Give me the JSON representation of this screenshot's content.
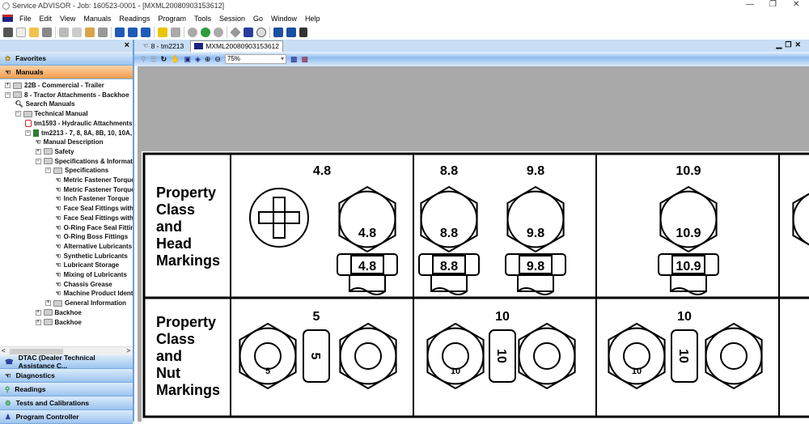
{
  "window": {
    "title": "Service ADVISOR - Job: 160523-0001 - [MXML20080903153612]",
    "controls": [
      "—",
      "❐",
      "✕"
    ]
  },
  "menu": [
    "File",
    "Edit",
    "View",
    "Manuals",
    "Readings",
    "Program",
    "Tools",
    "Session",
    "Go",
    "Window",
    "Help"
  ],
  "left_panel": {
    "close": "×",
    "favorites": "Favorites",
    "manuals": "Manuals",
    "tree": [
      {
        "label": "22B - Commercial - Trailer",
        "level": 0,
        "type": "folder",
        "exp": "+"
      },
      {
        "label": "8 - Tractor Attachments - Backhoe",
        "level": 0,
        "type": "folder",
        "exp": "-"
      },
      {
        "label": "Search Manuals",
        "level": 1,
        "type": "search",
        "exp": ""
      },
      {
        "label": "Technical Manual",
        "level": 1,
        "type": "folder",
        "exp": "-"
      },
      {
        "label": "tm1593 - Hydraulic Attachments",
        "level": 2,
        "type": "pdf",
        "exp": ""
      },
      {
        "label": "tm2213 - 7, 8, 8A, 8B, 10, 10A,",
        "level": 2,
        "type": "book",
        "exp": "-"
      },
      {
        "label": "Manual Description",
        "level": 3,
        "type": "doc",
        "exp": ""
      },
      {
        "label": "Safety",
        "level": 3,
        "type": "folder",
        "exp": "+"
      },
      {
        "label": "Specifications & Information",
        "level": 3,
        "type": "folder",
        "exp": "-"
      },
      {
        "label": "Specifications",
        "level": 4,
        "type": "folder",
        "exp": "-"
      },
      {
        "label": "Metric Fastener Torque",
        "level": 5,
        "type": "doc",
        "exp": ""
      },
      {
        "label": "Metric Fastener Torque",
        "level": 5,
        "type": "doc",
        "exp": ""
      },
      {
        "label": "Inch Fastener Torque",
        "level": 5,
        "type": "doc",
        "exp": ""
      },
      {
        "label": "Face Seal Fittings with",
        "level": 5,
        "type": "doc",
        "exp": ""
      },
      {
        "label": "Face Seal Fittings with",
        "level": 5,
        "type": "doc",
        "exp": ""
      },
      {
        "label": "O-Ring Face Seal Fittings",
        "level": 5,
        "type": "doc",
        "exp": ""
      },
      {
        "label": "O-Ring Boss Fittings",
        "level": 5,
        "type": "doc",
        "exp": ""
      },
      {
        "label": "Alternative Lubricants",
        "level": 5,
        "type": "doc",
        "exp": ""
      },
      {
        "label": "Synthetic Lubricants",
        "level": 5,
        "type": "doc",
        "exp": ""
      },
      {
        "label": "Lubricant Storage",
        "level": 5,
        "type": "doc",
        "exp": ""
      },
      {
        "label": "Mixing of Lubricants",
        "level": 5,
        "type": "doc",
        "exp": ""
      },
      {
        "label": "Chassis Grease",
        "level": 5,
        "type": "doc",
        "exp": ""
      },
      {
        "label": "Machine Product Identification",
        "level": 5,
        "type": "doc",
        "exp": ""
      },
      {
        "label": "General Information",
        "level": 4,
        "type": "folder",
        "exp": "+"
      },
      {
        "label": "Backhoe",
        "level": 3,
        "type": "folder",
        "exp": "+"
      },
      {
        "label": "Backhoe",
        "level": 3,
        "type": "folder",
        "exp": "+"
      }
    ],
    "scroll_left": "<",
    "scroll_right": ">",
    "nav": [
      "DTAC (Dealer Technical Assistance C...",
      "Diagnostics",
      "Readings",
      "Tests and Calibrations",
      "Program Controller"
    ]
  },
  "tabs": [
    {
      "label": "8 - tm2213"
    },
    {
      "label": "MXML20080903153612"
    }
  ],
  "doc_toolbar": {
    "zoom": "75%"
  },
  "document": {
    "head_row_label": [
      "Property",
      "Class",
      "and",
      "Head",
      "Markings"
    ],
    "nut_row_label": [
      "Property",
      "Class",
      "and",
      "Nut",
      "Markings"
    ],
    "head_classes": [
      {
        "title": "4.8",
        "marks": [
          "4.8"
        ]
      },
      {
        "title": "8.8",
        "marks": [
          "8.8"
        ]
      },
      {
        "title": "9.8",
        "marks": [
          "9.8"
        ]
      },
      {
        "title": "10.9",
        "marks": [
          "10.9"
        ]
      }
    ],
    "nut_classes": [
      {
        "title": "5",
        "mark": "5"
      },
      {
        "title": "10",
        "mark": "10"
      },
      {
        "title": "10",
        "mark": "10"
      }
    ]
  }
}
